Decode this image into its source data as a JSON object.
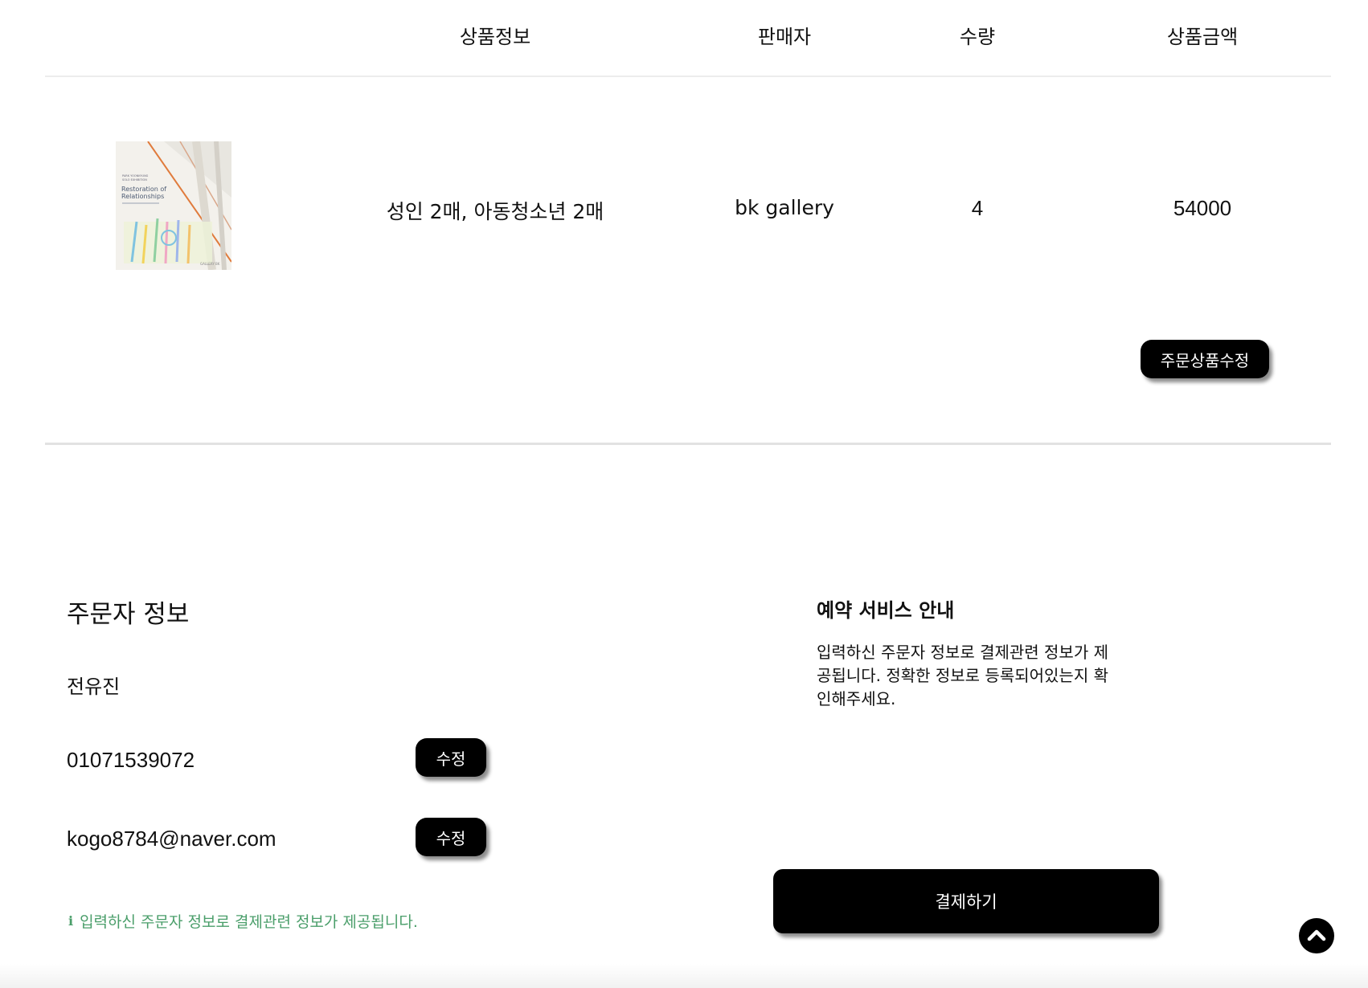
{
  "table": {
    "headers": {
      "product_info": "상품정보",
      "seller": "판매자",
      "quantity": "수량",
      "amount": "상품금액"
    },
    "row": {
      "product_desc": "성인 2매,  아동청소년 2매",
      "seller": "bk gallery",
      "quantity": "4",
      "amount": "54000",
      "thumbnail": {
        "line1": "PARK YOONKYUNG",
        "line2": "SOLO EXHIBITION",
        "title1": "Restoration of",
        "title2": "Relationships",
        "brand": "GALLERY BK"
      }
    },
    "edit_order_button": "주문상품수정"
  },
  "orderer": {
    "title": "주문자 정보",
    "name": "전유진",
    "phone": "01071539072",
    "email": "kogo8784@naver.com",
    "edit_label": "수정",
    "notice": "입력하신 주문자 정보로 결제관련 정보가 제공됩니다.",
    "notice_icon": "info-icon"
  },
  "guide": {
    "title": "예약 서비스 안내",
    "lines": [
      "입력하신 주문자 정보로 결제관련 정보가 제",
      "공됩니다. 정확한 정보로 등록되어있는지 확",
      "인해주세요."
    ]
  },
  "pay_button": "결제하기",
  "colors": {
    "button_bg": "#000000",
    "notice_green": "#4a9e6a",
    "divider": "#e3e3e3"
  }
}
